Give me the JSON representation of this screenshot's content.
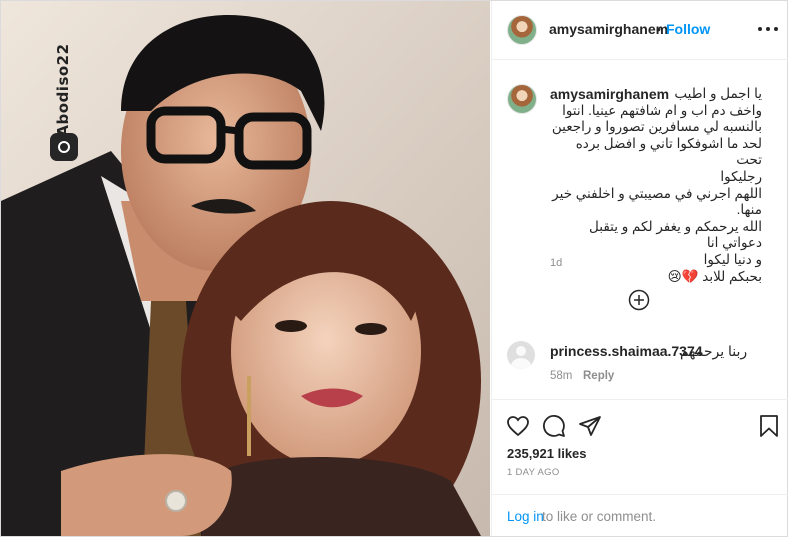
{
  "post": {
    "username": "amysamirghanem",
    "dot": "•",
    "follow_label": "Follow",
    "more_icon": "more-options-icon",
    "watermark_text": "Abodiso22"
  },
  "caption": {
    "username": "amysamirghanem",
    "text": "يا اجمل و اطيب\nواخف دم اب و ام شافتهم عينيا. انتوا\nبالنسبه لي مسافرين تصوروا و راجعين\nلحد ما اشوفكوا تاني و افضل برده تحت\nرجليكوا\nاللهم اجرني في مصيبتي و اخلفني خير\nمنها.\nالله يرحمكم و يغفر لكم و يتقبل دعواتي انا\nو دنيا ليكوا\nبحبكم للابد 💔😢",
    "time": "1d"
  },
  "load_more_icon": "plus-circle-icon",
  "comments": [
    {
      "username": "princess.shaimaa.7374",
      "text": "ربنا يرحمهم",
      "time": "58m",
      "reply_label": "Reply"
    }
  ],
  "actions": {
    "icons": [
      "heart-icon",
      "comment-icon",
      "share-icon",
      "bookmark-icon"
    ],
    "likes": "235,921 likes",
    "date": "1 DAY AGO"
  },
  "login": {
    "link_label": "Log in",
    "rest_text": "to like or comment."
  },
  "colors": {
    "link_blue": "#0095f6",
    "muted_gray": "#8e8e8e",
    "text": "#262626",
    "border": "#efefef"
  }
}
